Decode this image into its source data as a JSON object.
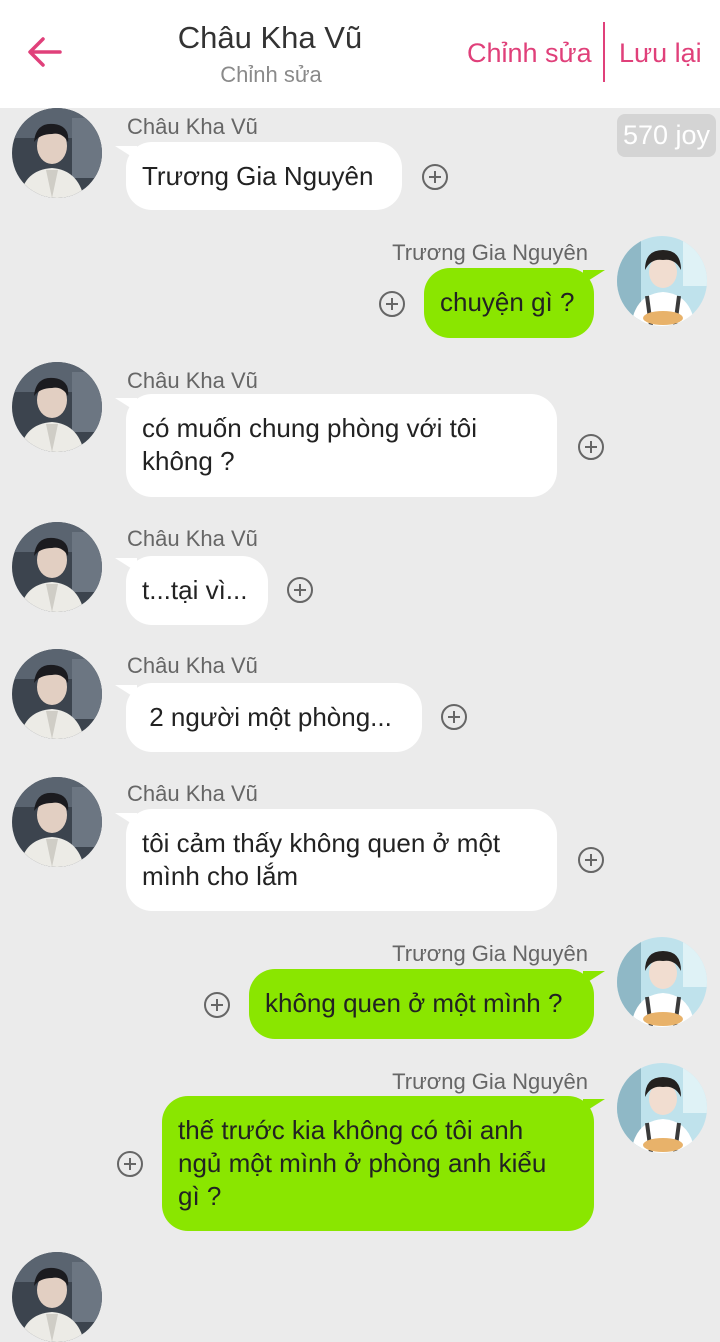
{
  "header": {
    "title": "Châu Kha Vũ",
    "subtitle": "Chỉnh sửa",
    "edit_label": "Chỉnh sửa",
    "save_label": "Lưu lại"
  },
  "badge": {
    "joy": "570 joy"
  },
  "colors": {
    "accent": "#e0407a",
    "sent_bubble": "#8ae600",
    "received_bubble": "#ffffff",
    "background": "#ebebeb"
  },
  "messages": [
    {
      "sender": "Châu Kha Vũ",
      "side": "left",
      "text": "Trương Gia Nguyên"
    },
    {
      "sender": "Trương Gia Nguyên",
      "side": "right",
      "text": "chuyện gì ?"
    },
    {
      "sender": "Châu Kha Vũ",
      "side": "left",
      "text": "có muốn chung phòng với tôi\nkhông ?"
    },
    {
      "sender": "Châu Kha Vũ",
      "side": "left",
      "text": "t...tại vì..."
    },
    {
      "sender": "Châu Kha Vũ",
      "side": "left",
      "text": " 2 người một phòng..."
    },
    {
      "sender": "Châu Kha Vũ",
      "side": "left",
      "text": "tôi cảm thấy không quen ở một\nmình cho lắm"
    },
    {
      "sender": "Trương Gia Nguyên",
      "side": "right",
      "text": "không quen ở một mình ?"
    },
    {
      "sender": "Trương Gia Nguyên",
      "side": "right",
      "text": "thế trước kia không có tôi anh\nngủ một mình ở phòng anh kiểu\ngì ?"
    }
  ],
  "icons": {
    "back": "arrow-left-icon",
    "add": "plus-circle-icon"
  }
}
